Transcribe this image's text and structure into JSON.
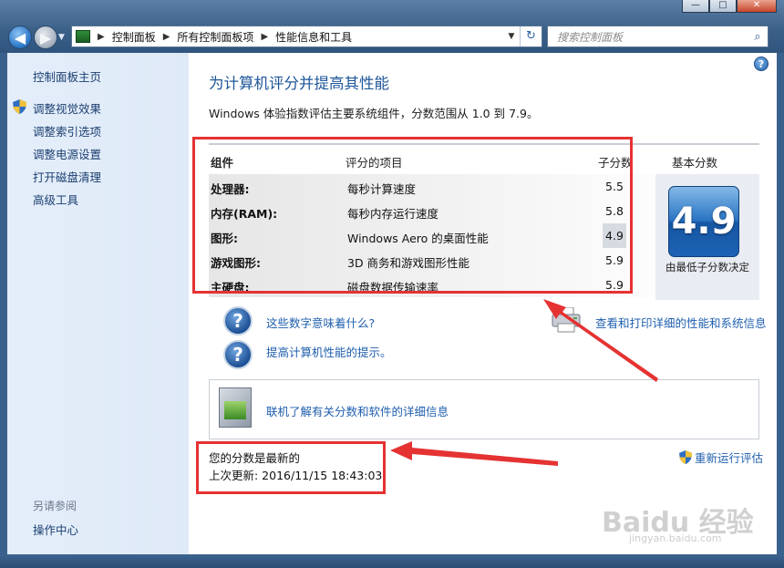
{
  "window": {
    "minimize_label": "—",
    "maximize_label": "□",
    "close_label": "✕"
  },
  "address": {
    "crumbs": [
      "控制面板",
      "所有控制面板项",
      "性能信息和工具"
    ]
  },
  "search": {
    "placeholder": "搜索控制面板"
  },
  "sidebar": {
    "home": "控制面板主页",
    "items": [
      "调整视觉效果",
      "调整索引选项",
      "调整电源设置",
      "打开磁盘清理",
      "高级工具"
    ],
    "see_also_label": "另请参阅",
    "see_also_items": [
      "操作中心"
    ]
  },
  "main": {
    "title": "为计算机评分并提高其性能",
    "subtitle": "Windows 体验指数评估主要系统组件，分数范围从 1.0 到 7.9。",
    "table": {
      "headers": {
        "component": "组件",
        "rated_item": "评分的项目",
        "subscore": "子分数",
        "base_score": "基本分数"
      },
      "rows": [
        {
          "component": "处理器:",
          "item": "每秒计算速度",
          "score": "5.5"
        },
        {
          "component": "内存(RAM):",
          "item": "每秒内存运行速度",
          "score": "5.8"
        },
        {
          "component": "图形:",
          "item": "Windows Aero 的桌面性能",
          "score": "4.9"
        },
        {
          "component": "游戏图形:",
          "item": "3D 商务和游戏图形性能",
          "score": "5.9"
        },
        {
          "component": "主硬盘:",
          "item": "磁盘数据传输速率",
          "score": "5.9"
        }
      ],
      "base_score": "4.9",
      "base_caption": "由最低子分数决定"
    },
    "links": {
      "what_mean": "这些数字意味着什么?",
      "tips": "提高计算机性能的提示。",
      "print_details": "查看和打印详细的性能和系统信息",
      "online_info": "联机了解有关分数和软件的详细信息"
    },
    "status": {
      "current": "您的分数是最新的",
      "last_update": "上次更新: 2016/11/15 18:43:03"
    },
    "rerun": "重新运行评估"
  },
  "watermark": {
    "logo": "Baidu 经验",
    "url": "jingyan.baidu.com"
  },
  "colors": {
    "annotation_red": "#e53232",
    "link_blue": "#1f5fae",
    "title_blue": "#1e5699",
    "score_tile": "#1c63b4"
  }
}
